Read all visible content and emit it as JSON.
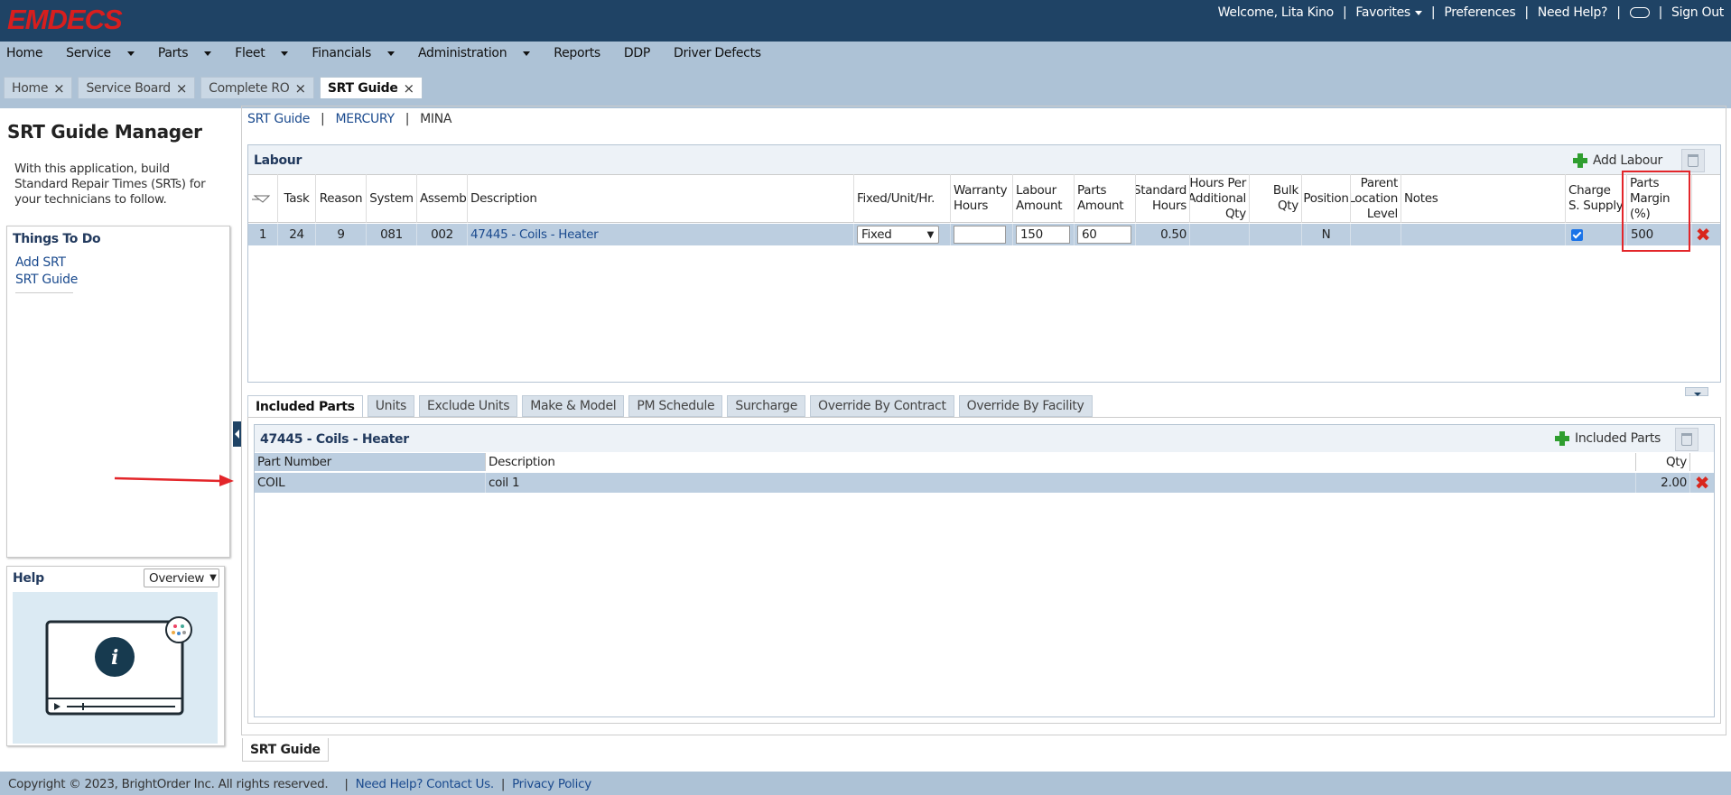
{
  "app": {
    "logo": "EMDECS"
  },
  "top_links": {
    "welcome": "Welcome, Lita Kino",
    "favorites": "Favorites",
    "preferences": "Preferences",
    "need_help": "Need Help?",
    "sign_out": "Sign Out"
  },
  "menu": [
    "Home",
    "Service",
    "Parts",
    "Fleet",
    "Financials",
    "Administration",
    "Reports",
    "DDP",
    "Driver Defects"
  ],
  "menu_dropdowns": [
    false,
    true,
    true,
    true,
    true,
    true,
    false,
    false,
    false
  ],
  "tabs": [
    {
      "label": "Home"
    },
    {
      "label": "Service Board"
    },
    {
      "label": "Complete RO"
    },
    {
      "label": "SRT Guide"
    }
  ],
  "left": {
    "title": "SRT Guide Manager",
    "description": "With this application, build Standard Repair Times (SRTs) for your technicians to follow.",
    "things_to_do": {
      "title": "Things To Do",
      "items": [
        "Add SRT",
        "SRT Guide"
      ]
    },
    "help": {
      "title": "Help",
      "select_value": "Overview"
    }
  },
  "breadcrumb": [
    "SRT Guide",
    "MERCURY",
    "MINA"
  ],
  "labour": {
    "title": "Labour",
    "add_label": "Add Labour",
    "columns": [
      "Task",
      "Reason",
      "System",
      "Assembly",
      "Description",
      "Fixed/Unit/Hr.",
      "Warranty Hours",
      "Labour Amount",
      "Parts Amount",
      "Standard Hours",
      "Hours Per Additional Qty",
      "Bulk Qty",
      "Position",
      "Parent Location Level",
      "Notes",
      "Charge S. Supply",
      "Parts Margin (%)"
    ],
    "rows": [
      {
        "num": "1",
        "task": "24",
        "reason": "9",
        "system": "081",
        "assembly": "002",
        "description": "47445 - Coils - Heater",
        "fixed": "Fixed",
        "warranty_hours": "",
        "labour_amount": "150",
        "parts_amount": "60",
        "standard_hours": "0.50",
        "hours_per_add": "",
        "bulk_qty": "",
        "position": "N",
        "parent_location": "",
        "notes": "",
        "charge_supply": true,
        "parts_margin": "500"
      }
    ]
  },
  "sub_tabs": [
    "Included Parts",
    "Units",
    "Exclude Units",
    "Make & Model",
    "PM Schedule",
    "Surcharge",
    "Override By Contract",
    "Override By Facility"
  ],
  "included_parts": {
    "title": "47445 - Coils - Heater",
    "add_label": "Included Parts",
    "columns": [
      "Part Number",
      "Description",
      "Qty"
    ],
    "rows": [
      {
        "part_number": "COIL",
        "description": "coil 1",
        "qty": "2.00"
      }
    ]
  },
  "bottom_tab": "SRT Guide",
  "footer": {
    "copyright": "Copyright © 2023, BrightOrder Inc. All rights reserved.",
    "contact": "Need Help? Contact Us.",
    "privacy": "Privacy Policy"
  },
  "colors": {
    "topbar": "#1f4365",
    "menubar": "#adc2d6",
    "row_highlight": "#bccee0",
    "logo": "#d81e1e",
    "annotation_red": "#e3262a"
  }
}
